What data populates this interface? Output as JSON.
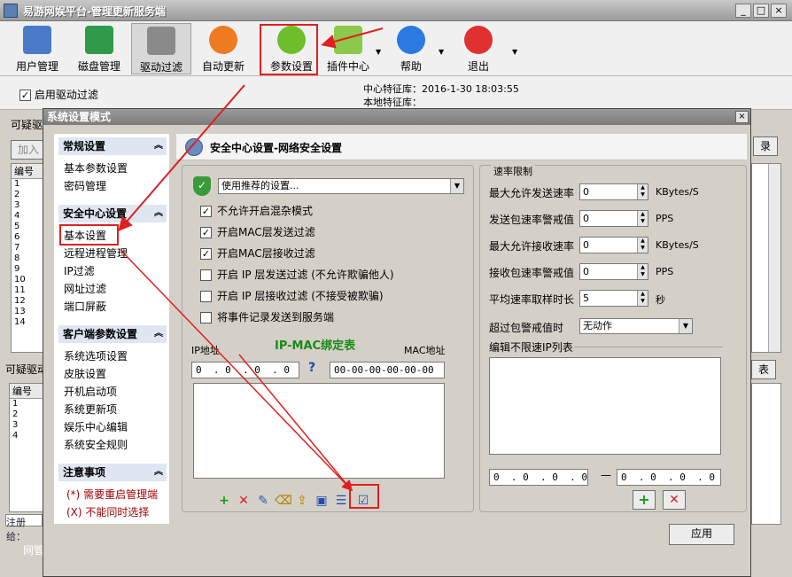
{
  "window": {
    "title": "易游网娱平台-管理更新服务端"
  },
  "toolbar": [
    {
      "label": "用户管理",
      "icon": "user-icon"
    },
    {
      "label": "磁盘管理",
      "icon": "disk-icon"
    },
    {
      "label": "驱动过滤",
      "icon": "wall-icon"
    },
    {
      "label": "自动更新",
      "icon": "update-icon"
    },
    {
      "label": "参数设置",
      "icon": "gear-icon"
    },
    {
      "label": "插件中心",
      "icon": "folder-icon"
    },
    {
      "label": "帮助",
      "icon": "help-icon"
    },
    {
      "label": "退出",
      "icon": "exit-icon"
    }
  ],
  "status": {
    "enable_driver_filter": "启用驱动过滤",
    "center_sig_label": "中心特征库：",
    "center_sig_value": "2016-1-30 18:03:55",
    "local_sig_label": "本地特征库："
  },
  "background": {
    "suspicious_label": "可疑驱",
    "suspicious_label2": "可疑驱动",
    "add_button": "加入",
    "col_num": "编号",
    "rows1": [
      "1",
      "2",
      "3",
      "4",
      "5",
      "6",
      "7",
      "8",
      "9",
      "10",
      "11",
      "12",
      "13",
      "14"
    ],
    "rows2": [
      "1",
      "2",
      "3",
      "4"
    ],
    "btn_right1": "录",
    "btn_right2": "表",
    "footer": "注册给：",
    "footer2": "网管"
  },
  "dialog": {
    "title": "系统设置模式",
    "close": "×",
    "header": "安全中心设置-网络安全设置",
    "apply": "应用"
  },
  "sidebar": {
    "sections": [
      {
        "title": "常规设置",
        "items": [
          "基本参数设置",
          "密码管理"
        ]
      },
      {
        "title": "安全中心设置",
        "items": [
          "基本设置",
          "远程进程管理",
          "IP过滤",
          "网址过滤",
          "端口屏蔽"
        ]
      },
      {
        "title": "客户端参数设置",
        "items": [
          "系统选项设置",
          "皮肤设置",
          "开机启动项",
          "系统更新项",
          "娱乐中心编辑",
          "系统安全规则"
        ]
      },
      {
        "title": "注意事项",
        "notes": [
          "(*) 需要重启管理端",
          "(X) 不能同时选择"
        ]
      }
    ]
  },
  "security": {
    "preset": "使用推荐的设置...",
    "options": [
      {
        "label": "不允许开启混杂模式",
        "checked": true
      },
      {
        "label": "开启MAC层发送过滤",
        "checked": true
      },
      {
        "label": "开启MAC层接收过滤",
        "checked": true
      },
      {
        "label": "开启 IP 层发送过滤 (不允许欺骗他人)",
        "checked": false
      },
      {
        "label": "开启 IP 层接收过滤 (不接受被欺骗)",
        "checked": false
      },
      {
        "label": "将事件记录发送到服务端",
        "checked": false
      }
    ],
    "ip_label": "IP地址",
    "table_title": "IP-MAC绑定表",
    "mac_label": "MAC地址",
    "ip_value": "0  . 0  . 0  . 0",
    "mac_value": "00-00-00-00-00-00",
    "help": "?"
  },
  "rate": {
    "title": "速率限制",
    "rows": [
      {
        "label": "最大允许发送速率",
        "value": "0",
        "unit": "KBytes/S"
      },
      {
        "label": "发送包速率警戒值",
        "value": "0",
        "unit": "PPS"
      },
      {
        "label": "最大允许接收速率",
        "value": "0",
        "unit": "KBytes/S"
      },
      {
        "label": "接收包速率警戒值",
        "value": "0",
        "unit": "PPS"
      },
      {
        "label": "平均速率取样时长",
        "value": "5",
        "unit": "秒"
      }
    ],
    "alert_label": "超过包警戒值时",
    "alert_value": "无动作",
    "unlimited_label": "编辑不限速IP列表",
    "ip_from": "0  . 0  . 0  . 0",
    "dash": "—",
    "ip_to": "0  . 0  . 0  . 0"
  },
  "colors": {
    "accent_red": "#e02020",
    "section_bg": "#dfe6f2",
    "mac_title": "#1a8a1a"
  }
}
